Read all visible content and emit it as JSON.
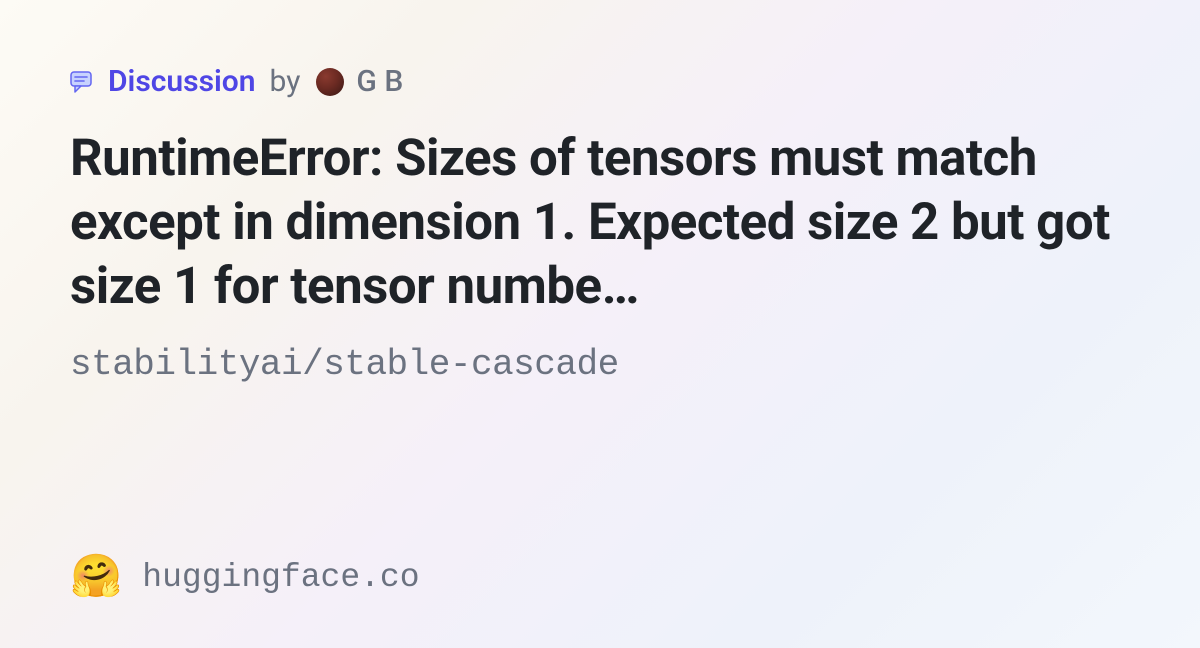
{
  "header": {
    "discussion_label": "Discussion",
    "by_label": "by",
    "author_name": "G B"
  },
  "main": {
    "title": "RuntimeError: Sizes of tensors must match except in dimension 1. Expected size 2 but got size 1 for tensor numbe…",
    "repo_path": "stabilityai/stable-cascade"
  },
  "footer": {
    "emoji": "🤗",
    "domain": "huggingface.co"
  }
}
